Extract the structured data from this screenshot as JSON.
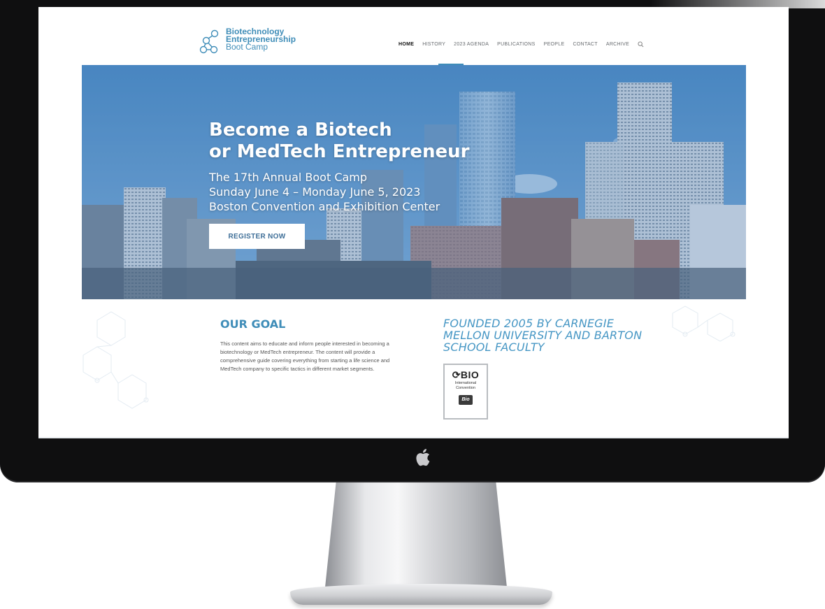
{
  "logo": {
    "line1": "Biotechnology",
    "line2": "Entrepreneurship",
    "line3": "Boot Camp"
  },
  "nav": {
    "items": [
      "HOME",
      "HISTORY",
      "2023 AGENDA",
      "PUBLICATIONS",
      "PEOPLE",
      "CONTACT",
      "ARCHIVE"
    ],
    "search_icon": "search-icon"
  },
  "hero": {
    "title_line1": "Become a Biotech",
    "title_line2": "or MedTech Entrepreneur",
    "sub_line1": "The 17th Annual Boot Camp",
    "sub_line2": "Sunday June 4 – Monday June 5, 2023",
    "sub_line3": "Boston Convention and Exhibition Center",
    "register_label": "REGISTER NOW"
  },
  "goal": {
    "title": "OUR GOAL",
    "text": "This content aims to educate and inform people interested in becoming a biotechnology or MedTech entrepreneur. The content will provide a comprehensive guide covering everything from starting a life science and MedTech company to specific tactics in different market segments."
  },
  "founded": {
    "text": "FOUNDED 2005 BY CARNEGIE MELLON UNIVERSITY AND BARTON SCHOOL FACULTY"
  },
  "badge": {
    "big": "BIO",
    "small1": "International",
    "small2": "Convention",
    "tag": "Bio"
  },
  "colors": {
    "accent": "#3f8db8",
    "bezel": "#0f0f10"
  }
}
